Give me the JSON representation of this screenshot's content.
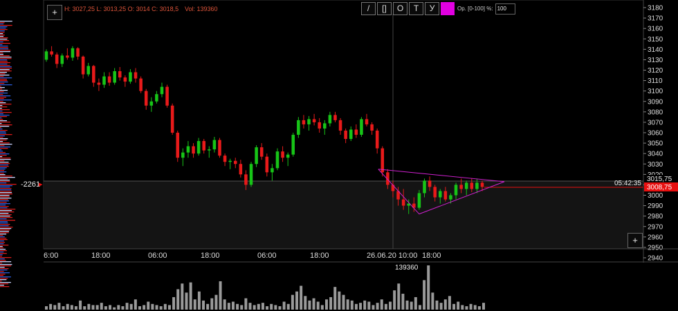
{
  "header": {
    "ohlc_text": "H: 3027,25 L: 3013,25 O: 3014 C: 3018,5",
    "volume_text": "Vol: 139360",
    "label_color": "#e0553a"
  },
  "toolbar": {
    "buttons": [
      "/",
      "[]",
      "O",
      "T",
      "У"
    ],
    "color_swatch": "#e100e1",
    "opacity_label": "Op. [0-100] %:",
    "opacity_value": "100"
  },
  "plus_buttons": {
    "top": "+",
    "bottom": "+"
  },
  "left_profile": {
    "value_label": "-2261"
  },
  "price_axis": {
    "ticks": [
      "3180",
      "3170",
      "3160",
      "3150",
      "3140",
      "3130",
      "3120",
      "3110",
      "3100",
      "3090",
      "3080",
      "3070",
      "3060",
      "3050",
      "3040",
      "3030",
      "3020",
      "3010",
      "3000",
      "2990",
      "2980",
      "2970",
      "2960",
      "2950",
      "2940"
    ],
    "crosshair_price": "3015,75",
    "last_price": "3008,75",
    "countdown": "05:42:35",
    "last_price_color": "#e81010"
  },
  "time_axis": {
    "labels": [
      "6:00",
      "18:00",
      "06:00",
      "18:00",
      "06:00",
      "18:00",
      "26.06.20 10:00",
      "18:00"
    ]
  },
  "volume_panel": {
    "peak_label": "139360"
  },
  "chart_data": {
    "type": "candlestick",
    "ylim": [
      2940,
      3185
    ],
    "colors": {
      "up": "#17c417",
      "down": "#e81a1a",
      "triangle": "#d020d0"
    },
    "candles": [
      [
        3130,
        3140,
        3128,
        3138
      ],
      [
        3138,
        3143,
        3133,
        3135
      ],
      [
        3135,
        3137,
        3122,
        3126
      ],
      [
        3126,
        3136,
        3123,
        3134
      ],
      [
        3134,
        3141,
        3130,
        3132
      ],
      [
        3132,
        3143,
        3129,
        3141
      ],
      [
        3141,
        3142,
        3130,
        3133
      ],
      [
        3133,
        3134,
        3112,
        3116
      ],
      [
        3116,
        3127,
        3114,
        3124
      ],
      [
        3124,
        3125,
        3104,
        3108
      ],
      [
        3108,
        3112,
        3100,
        3106
      ],
      [
        3106,
        3118,
        3103,
        3114
      ],
      [
        3114,
        3118,
        3105,
        3108
      ],
      [
        3108,
        3122,
        3106,
        3119
      ],
      [
        3119,
        3123,
        3110,
        3113
      ],
      [
        3113,
        3115,
        3104,
        3109
      ],
      [
        3109,
        3121,
        3107,
        3118
      ],
      [
        3118,
        3122,
        3108,
        3112
      ],
      [
        3112,
        3114,
        3098,
        3100
      ],
      [
        3100,
        3102,
        3082,
        3086
      ],
      [
        3086,
        3094,
        3080,
        3090
      ],
      [
        3090,
        3100,
        3088,
        3097
      ],
      [
        3097,
        3108,
        3094,
        3104
      ],
      [
        3104,
        3106,
        3084,
        3086
      ],
      [
        3086,
        3088,
        3058,
        3060
      ],
      [
        3060,
        3062,
        3032,
        3036
      ],
      [
        3036,
        3045,
        3028,
        3041
      ],
      [
        3041,
        3052,
        3036,
        3047
      ],
      [
        3047,
        3050,
        3036,
        3040
      ],
      [
        3040,
        3055,
        3038,
        3052
      ],
      [
        3052,
        3054,
        3040,
        3043
      ],
      [
        3043,
        3047,
        3036,
        3044
      ],
      [
        3044,
        3056,
        3041,
        3053
      ],
      [
        3053,
        3055,
        3036,
        3038
      ],
      [
        3038,
        3040,
        3028,
        3032
      ],
      [
        3032,
        3035,
        3025,
        3033
      ],
      [
        3033,
        3036,
        3026,
        3030
      ],
      [
        3030,
        3034,
        3017,
        3020
      ],
      [
        3020,
        3024,
        3005,
        3010
      ],
      [
        3010,
        3032,
        3008,
        3030
      ],
      [
        3030,
        3048,
        3027,
        3046
      ],
      [
        3046,
        3050,
        3034,
        3037
      ],
      [
        3037,
        3040,
        3018,
        3022
      ],
      [
        3022,
        3030,
        3014,
        3026
      ],
      [
        3026,
        3045,
        3024,
        3042
      ],
      [
        3042,
        3047,
        3032,
        3036
      ],
      [
        3036,
        3041,
        3028,
        3039
      ],
      [
        3039,
        3060,
        3037,
        3058
      ],
      [
        3058,
        3075,
        3055,
        3072
      ],
      [
        3072,
        3077,
        3064,
        3068
      ],
      [
        3068,
        3076,
        3062,
        3073
      ],
      [
        3073,
        3078,
        3067,
        3070
      ],
      [
        3070,
        3074,
        3060,
        3064
      ],
      [
        3064,
        3072,
        3058,
        3069
      ],
      [
        3069,
        3080,
        3066,
        3077
      ],
      [
        3077,
        3080,
        3070,
        3072
      ],
      [
        3072,
        3074,
        3058,
        3062
      ],
      [
        3062,
        3064,
        3050,
        3054
      ],
      [
        3054,
        3066,
        3052,
        3063
      ],
      [
        3063,
        3068,
        3055,
        3058
      ],
      [
        3058,
        3075,
        3056,
        3073
      ],
      [
        3073,
        3078,
        3066,
        3068
      ],
      [
        3068,
        3070,
        3058,
        3062
      ],
      [
        3062,
        3064,
        3040,
        3045
      ],
      [
        3045,
        3047,
        3018,
        3022
      ],
      [
        3022,
        3025,
        3006,
        3010
      ],
      [
        3010,
        3014,
        2998,
        3004
      ],
      [
        3004,
        3008,
        2990,
        2996
      ],
      [
        2996,
        3006,
        2986,
        2990
      ],
      [
        2990,
        2996,
        2982,
        2992
      ],
      [
        2992,
        2998,
        2984,
        2988
      ],
      [
        2988,
        3005,
        2986,
        3002
      ],
      [
        3002,
        3016,
        2998,
        3014
      ],
      [
        3014,
        3018,
        3004,
        3008
      ],
      [
        3008,
        3010,
        2994,
        2998
      ],
      [
        2998,
        3006,
        2992,
        3004
      ],
      [
        3004,
        3008,
        2994,
        2996
      ],
      [
        2996,
        3002,
        2992,
        3000
      ],
      [
        3000,
        3012,
        2996,
        3010
      ],
      [
        3010,
        3016,
        3002,
        3006
      ],
      [
        3006,
        3014,
        3000,
        3012
      ],
      [
        3012,
        3016,
        3003,
        3006
      ],
      [
        3006,
        3016,
        3002,
        3012
      ],
      [
        3012,
        3014,
        3004,
        3008
      ]
    ],
    "volumes": [
      3,
      5,
      4,
      6,
      3,
      5,
      4,
      3,
      8,
      3,
      5,
      4,
      4,
      6,
      3,
      4,
      2,
      4,
      3,
      6,
      5,
      9,
      3,
      4,
      7,
      5,
      4,
      3,
      5,
      4,
      11,
      18,
      23,
      15,
      24,
      9,
      16,
      8,
      5,
      10,
      13,
      25,
      9,
      6,
      7,
      5,
      4,
      10,
      6,
      4,
      5,
      6,
      3,
      5,
      4,
      3,
      7,
      5,
      13,
      16,
      21,
      12,
      8,
      10,
      7,
      4,
      9,
      11,
      20,
      16,
      13,
      9,
      8,
      5,
      6,
      8,
      7,
      4,
      6,
      9,
      5,
      7,
      17,
      23,
      14,
      8,
      7,
      11,
      4,
      26,
      39,
      15,
      8,
      6,
      9,
      12,
      5,
      7,
      4,
      3,
      5,
      4,
      3,
      6
    ],
    "time_labels": [
      "6:00",
      "18:00",
      "06:00",
      "18:00",
      "06:00",
      "18:00",
      "26.06.20 10:00",
      "18:00"
    ],
    "triangle": [
      [
        3025,
        "upper-left"
      ],
      [
        2982,
        "bottom"
      ],
      [
        3013,
        "apex"
      ]
    ]
  }
}
